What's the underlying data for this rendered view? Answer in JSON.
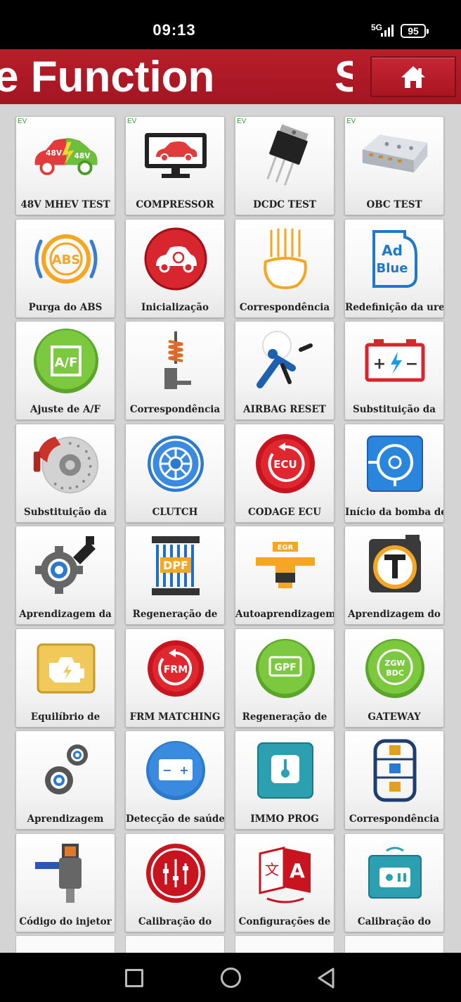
{
  "status_bar": {
    "time": "09:13",
    "network": "5G",
    "battery": "95"
  },
  "header": {
    "title": "e Function",
    "title_tail": "S",
    "home_icon": "home-icon"
  },
  "colors": {
    "brand_red": "#a81520",
    "grid_background": "#d4d4d4",
    "tile_background": "#f4f4f4",
    "ev_badge": "#3a9a3a"
  },
  "tiles": [
    {
      "label": "48V MHEV TEST",
      "ev": "EV",
      "icon": "hybrid-car-48v-icon"
    },
    {
      "label": "COMPRESSOR",
      "ev": "EV",
      "icon": "monitor-car-icon"
    },
    {
      "label": "DCDC TEST",
      "ev": "EV",
      "icon": "transistor-chip-icon"
    },
    {
      "label": "OBC TEST",
      "ev": "EV",
      "icon": "charger-module-icon"
    },
    {
      "label": "Purga do ABS",
      "ev": "",
      "icon": "abs-icon"
    },
    {
      "label": "Inicialização",
      "ev": "",
      "icon": "car-reset-icon"
    },
    {
      "label": "Correspondência",
      "ev": "",
      "icon": "headlight-icon"
    },
    {
      "label": "Redefinição da ureia",
      "ev": "",
      "icon": "adblue-icon"
    },
    {
      "label": "Ajuste de A/F",
      "ev": "",
      "icon": "air-fuel-icon"
    },
    {
      "label": "Correspondência",
      "ev": "",
      "icon": "suspension-icon"
    },
    {
      "label": "AIRBAG RESET",
      "ev": "",
      "icon": "airbag-icon"
    },
    {
      "label": "Substituição da",
      "ev": "",
      "icon": "battery-icon"
    },
    {
      "label": "Substituição da",
      "ev": "",
      "icon": "brake-disc-icon"
    },
    {
      "label": "CLUTCH",
      "ev": "",
      "icon": "clutch-icon"
    },
    {
      "label": "CODAGE ECU",
      "ev": "",
      "icon": "ecu-icon"
    },
    {
      "label": "Início da bomba de",
      "ev": "",
      "icon": "pump-icon"
    },
    {
      "label": "Aprendizagem da",
      "ev": "",
      "icon": "gear-learning-icon"
    },
    {
      "label": "Regeneração de",
      "ev": "",
      "icon": "dpf-icon"
    },
    {
      "label": "Autoaprendizagem",
      "ev": "",
      "icon": "egr-icon"
    },
    {
      "label": "Aprendizagem do",
      "ev": "",
      "icon": "throttle-icon"
    },
    {
      "label": "Equilíbrio de",
      "ev": "",
      "icon": "engine-icon"
    },
    {
      "label": "FRM MATCHING",
      "ev": "",
      "icon": "frm-icon"
    },
    {
      "label": "Regeneração de",
      "ev": "",
      "icon": "gpf-icon"
    },
    {
      "label": "GATEWAY",
      "ev": "",
      "icon": "gateway-icon"
    },
    {
      "label": "Aprendizagem",
      "ev": "",
      "icon": "gears-icon"
    },
    {
      "label": "Detecção de saúde",
      "ev": "",
      "icon": "battery-health-icon"
    },
    {
      "label": "IMMO PROG",
      "ev": "",
      "icon": "immo-key-icon"
    },
    {
      "label": "Correspondência",
      "ev": "",
      "icon": "seat-lock-icon"
    },
    {
      "label": "Código do injetor",
      "ev": "",
      "icon": "injector-icon"
    },
    {
      "label": "Calibração do",
      "ev": "",
      "icon": "calibration-target-icon"
    },
    {
      "label": "Configurações de",
      "ev": "",
      "icon": "language-icon"
    },
    {
      "label": "Calibração do",
      "ev": "",
      "icon": "radar-sensor-icon"
    }
  ]
}
